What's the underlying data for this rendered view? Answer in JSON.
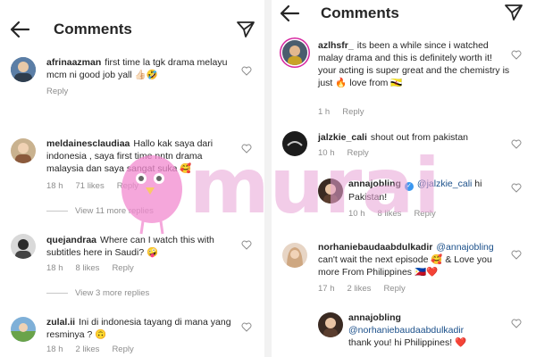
{
  "colors": {
    "text": "#262626",
    "meta": "#8e8e8e",
    "mention": "#1a4f8a",
    "watermark": "#e9a3d6",
    "watermark_bird": "#f28ad0",
    "heart_emoji": "#d81e2c",
    "verified": "#3897f0"
  },
  "left": {
    "header": {
      "title": "Comments",
      "back_icon": "arrow-left-icon",
      "send_icon": "paper-plane-icon"
    },
    "comments": [
      {
        "user": "afrinaazman",
        "text": "first time la tgk drama melayu mcm ni good job yall 👍🏻🤣",
        "time": "",
        "likes": "",
        "reply": "Reply"
      },
      {
        "user": "meldainesclaudiaa",
        "text": "Hallo kak saya dari indonesia , saya first time nntn drama malaysia dan saya sangat suka 🥰",
        "time": "18 h",
        "likes": "71 likes",
        "reply": "Reply",
        "view_more": "View 11 more replies"
      },
      {
        "user": "quejandraa",
        "text": "Where can I watch this with subtitles here in Saudi? 🤪",
        "time": "18 h",
        "likes": "8 likes",
        "reply": "Reply",
        "view_more": "View 3 more replies"
      },
      {
        "user": "zulal.ii",
        "text": "Ini di indonesia tayang di mana yang resminya ? 🙃",
        "time": "18 h",
        "likes": "2 likes",
        "reply": "Reply"
      }
    ]
  },
  "right": {
    "header": {
      "title": "Comments",
      "back_icon": "arrow-left-icon",
      "send_icon": "paper-plane-icon"
    },
    "comments": [
      {
        "user": "azlhsfr_",
        "text": "its been a while since i watched malay drama and this is definitely worth it! your acting is super great and the chemistry is just 🔥 love from 🇧🇳",
        "time": "1 h",
        "likes": "",
        "reply": "Reply"
      },
      {
        "user": "jalzkie_cali",
        "text": "shout out from pakistan",
        "time": "10 h",
        "likes": "",
        "reply": "Reply"
      },
      {
        "user": "annajobling",
        "mention": "@jalzkie_cali",
        "text": "hi Pakistan!",
        "time": "10 h",
        "likes": "8 likes",
        "reply": "Reply"
      },
      {
        "user": "norhaniebaudaabdulkadir",
        "mention": "@annajobling",
        "text": "can't wait the next episode 🥰 & Love you more From Philippines 🇵🇭❤️",
        "time": "17 h",
        "likes": "2 likes",
        "reply": "Reply"
      },
      {
        "user": "annajobling",
        "mention": "@norhaniebaudaabdulkadir",
        "text": "thank you! hi Philippines! ❤️",
        "time": "",
        "likes": "",
        "reply": ""
      }
    ]
  },
  "watermark": {
    "text": "murai"
  }
}
